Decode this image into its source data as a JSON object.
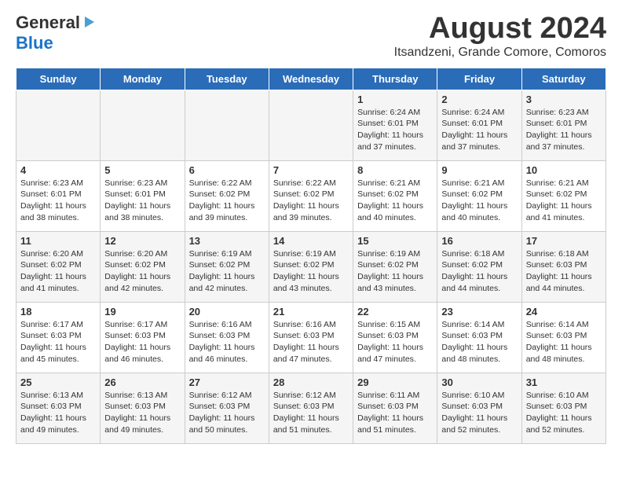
{
  "header": {
    "logo_general": "General",
    "logo_blue": "Blue",
    "title": "August 2024",
    "subtitle": "Itsandzeni, Grande Comore, Comoros"
  },
  "days_of_week": [
    "Sunday",
    "Monday",
    "Tuesday",
    "Wednesday",
    "Thursday",
    "Friday",
    "Saturday"
  ],
  "weeks": [
    [
      {
        "day": "",
        "info": ""
      },
      {
        "day": "",
        "info": ""
      },
      {
        "day": "",
        "info": ""
      },
      {
        "day": "",
        "info": ""
      },
      {
        "day": "1",
        "info": "Sunrise: 6:24 AM\nSunset: 6:01 PM\nDaylight: 11 hours and 37 minutes."
      },
      {
        "day": "2",
        "info": "Sunrise: 6:24 AM\nSunset: 6:01 PM\nDaylight: 11 hours and 37 minutes."
      },
      {
        "day": "3",
        "info": "Sunrise: 6:23 AM\nSunset: 6:01 PM\nDaylight: 11 hours and 37 minutes."
      }
    ],
    [
      {
        "day": "4",
        "info": "Sunrise: 6:23 AM\nSunset: 6:01 PM\nDaylight: 11 hours and 38 minutes."
      },
      {
        "day": "5",
        "info": "Sunrise: 6:23 AM\nSunset: 6:01 PM\nDaylight: 11 hours and 38 minutes."
      },
      {
        "day": "6",
        "info": "Sunrise: 6:22 AM\nSunset: 6:02 PM\nDaylight: 11 hours and 39 minutes."
      },
      {
        "day": "7",
        "info": "Sunrise: 6:22 AM\nSunset: 6:02 PM\nDaylight: 11 hours and 39 minutes."
      },
      {
        "day": "8",
        "info": "Sunrise: 6:21 AM\nSunset: 6:02 PM\nDaylight: 11 hours and 40 minutes."
      },
      {
        "day": "9",
        "info": "Sunrise: 6:21 AM\nSunset: 6:02 PM\nDaylight: 11 hours and 40 minutes."
      },
      {
        "day": "10",
        "info": "Sunrise: 6:21 AM\nSunset: 6:02 PM\nDaylight: 11 hours and 41 minutes."
      }
    ],
    [
      {
        "day": "11",
        "info": "Sunrise: 6:20 AM\nSunset: 6:02 PM\nDaylight: 11 hours and 41 minutes."
      },
      {
        "day": "12",
        "info": "Sunrise: 6:20 AM\nSunset: 6:02 PM\nDaylight: 11 hours and 42 minutes."
      },
      {
        "day": "13",
        "info": "Sunrise: 6:19 AM\nSunset: 6:02 PM\nDaylight: 11 hours and 42 minutes."
      },
      {
        "day": "14",
        "info": "Sunrise: 6:19 AM\nSunset: 6:02 PM\nDaylight: 11 hours and 43 minutes."
      },
      {
        "day": "15",
        "info": "Sunrise: 6:19 AM\nSunset: 6:02 PM\nDaylight: 11 hours and 43 minutes."
      },
      {
        "day": "16",
        "info": "Sunrise: 6:18 AM\nSunset: 6:02 PM\nDaylight: 11 hours and 44 minutes."
      },
      {
        "day": "17",
        "info": "Sunrise: 6:18 AM\nSunset: 6:03 PM\nDaylight: 11 hours and 44 minutes."
      }
    ],
    [
      {
        "day": "18",
        "info": "Sunrise: 6:17 AM\nSunset: 6:03 PM\nDaylight: 11 hours and 45 minutes."
      },
      {
        "day": "19",
        "info": "Sunrise: 6:17 AM\nSunset: 6:03 PM\nDaylight: 11 hours and 46 minutes."
      },
      {
        "day": "20",
        "info": "Sunrise: 6:16 AM\nSunset: 6:03 PM\nDaylight: 11 hours and 46 minutes."
      },
      {
        "day": "21",
        "info": "Sunrise: 6:16 AM\nSunset: 6:03 PM\nDaylight: 11 hours and 47 minutes."
      },
      {
        "day": "22",
        "info": "Sunrise: 6:15 AM\nSunset: 6:03 PM\nDaylight: 11 hours and 47 minutes."
      },
      {
        "day": "23",
        "info": "Sunrise: 6:14 AM\nSunset: 6:03 PM\nDaylight: 11 hours and 48 minutes."
      },
      {
        "day": "24",
        "info": "Sunrise: 6:14 AM\nSunset: 6:03 PM\nDaylight: 11 hours and 48 minutes."
      }
    ],
    [
      {
        "day": "25",
        "info": "Sunrise: 6:13 AM\nSunset: 6:03 PM\nDaylight: 11 hours and 49 minutes."
      },
      {
        "day": "26",
        "info": "Sunrise: 6:13 AM\nSunset: 6:03 PM\nDaylight: 11 hours and 49 minutes."
      },
      {
        "day": "27",
        "info": "Sunrise: 6:12 AM\nSunset: 6:03 PM\nDaylight: 11 hours and 50 minutes."
      },
      {
        "day": "28",
        "info": "Sunrise: 6:12 AM\nSunset: 6:03 PM\nDaylight: 11 hours and 51 minutes."
      },
      {
        "day": "29",
        "info": "Sunrise: 6:11 AM\nSunset: 6:03 PM\nDaylight: 11 hours and 51 minutes."
      },
      {
        "day": "30",
        "info": "Sunrise: 6:10 AM\nSunset: 6:03 PM\nDaylight: 11 hours and 52 minutes."
      },
      {
        "day": "31",
        "info": "Sunrise: 6:10 AM\nSunset: 6:03 PM\nDaylight: 11 hours and 52 minutes."
      }
    ]
  ]
}
